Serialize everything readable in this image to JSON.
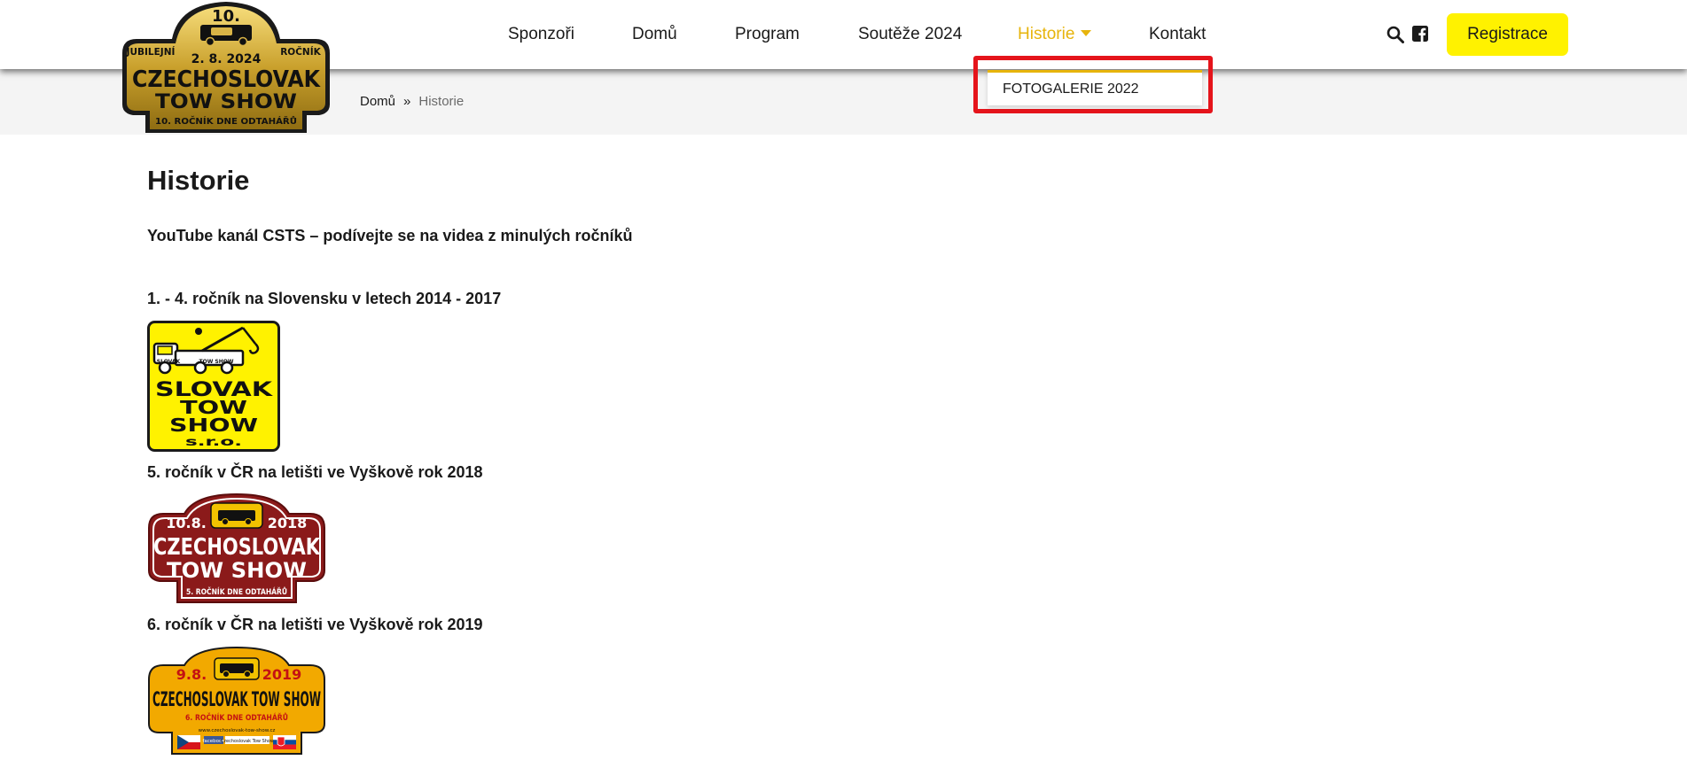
{
  "logo": {
    "number": "10.",
    "date": "2. 8. 2024",
    "left": "JUBILEJNÍ",
    "right": "ROČNÍK",
    "line1": "CZECHOSLOVAK",
    "line2": "TOW SHOW",
    "bottom": "10. ROČNÍK DNE ODTAHÁŘŮ"
  },
  "nav": {
    "items": [
      {
        "label": "Sponzoři"
      },
      {
        "label": "Domů"
      },
      {
        "label": "Program"
      },
      {
        "label": "Soutěže 2024"
      },
      {
        "label": "Historie"
      },
      {
        "label": "Kontakt"
      }
    ],
    "register_label": "Registrace"
  },
  "dropdown": {
    "items": [
      {
        "label": "FOTOGALERIE 2022"
      }
    ]
  },
  "breadcrumb": {
    "home": "Domů",
    "separator": "»",
    "current": "Historie"
  },
  "page": {
    "title": "Historie",
    "youtube_link": "YouTube kanál CSTS – podívejte se na videa z minulých ročníků",
    "sections": [
      {
        "heading": "1. - 4. ročník na Slovensku v letech 2014 - 2017"
      },
      {
        "heading": "5. ročník v ČR na letišti ve Vyškově rok 2018"
      },
      {
        "heading": "6. ročník v ČR na letišti ve Vyškově rok 2019"
      }
    ]
  },
  "badges": {
    "slovak": {
      "w1": "SLOVAK",
      "w2": "TOW",
      "w3": "SHOW",
      "w4": "s.r.o.",
      "small_left": "SLOVAK",
      "small_right": "TOW SHOW"
    },
    "y2018": {
      "date": "10.8.",
      "year": "2018",
      "line1": "CZECHOSLOVAK",
      "line2": "TOW SHOW",
      "bottom": "5. ROČNÍK DNE ODTAHÁŘŮ"
    },
    "y2019": {
      "date": "9.8.",
      "year": "2019",
      "line1": "CZECHOSLOVAK TOW SHOW",
      "bottom": "6. ROČNÍK DNE ODTAHÁŘŮ",
      "url": "www.czechoslovak-tow-show.cz",
      "fb": "facebook",
      "fb_page": "Czechoslovak Tow Show"
    }
  },
  "colors": {
    "accent": "#e7b40c",
    "register_bg": "#fff200",
    "highlight": "#e5141b",
    "badge_2018": "#8b1a1a",
    "badge_2019": "#f2a900",
    "slovak_yellow": "#fff200"
  }
}
